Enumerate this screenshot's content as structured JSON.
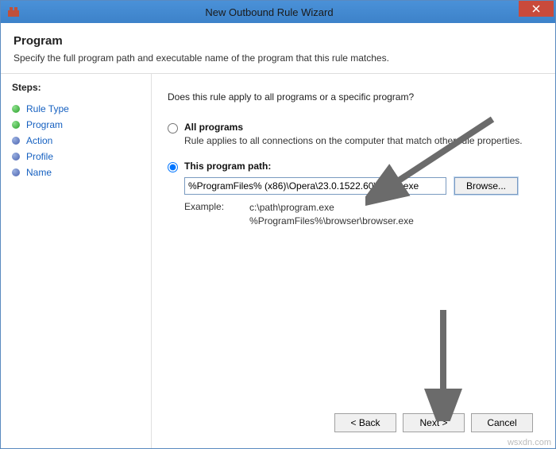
{
  "titlebar": {
    "title": "New Outbound Rule Wizard"
  },
  "header": {
    "title": "Program",
    "subtitle": "Specify the full program path and executable name of the program that this rule matches."
  },
  "sidebar": {
    "label": "Steps:",
    "items": [
      {
        "label": "Rule Type",
        "state": "done"
      },
      {
        "label": "Program",
        "state": "current"
      },
      {
        "label": "Action",
        "state": "pending"
      },
      {
        "label": "Profile",
        "state": "pending"
      },
      {
        "label": "Name",
        "state": "pending"
      }
    ]
  },
  "main": {
    "question": "Does this rule apply to all programs or a specific program?",
    "option_all": {
      "title": "All programs",
      "desc": "Rule applies to all connections on the computer that match other rule properties."
    },
    "option_path": {
      "title": "This program path:",
      "value": "%ProgramFiles% (x86)\\Opera\\23.0.1522.60\\opera.exe",
      "browse_label": "Browse...",
      "example_label": "Example:",
      "example_line1": "c:\\path\\program.exe",
      "example_line2": "%ProgramFiles%\\browser\\browser.exe"
    }
  },
  "buttons": {
    "back": "< Back",
    "next": "Next >",
    "cancel": "Cancel"
  },
  "watermark": "wsxdn.com"
}
